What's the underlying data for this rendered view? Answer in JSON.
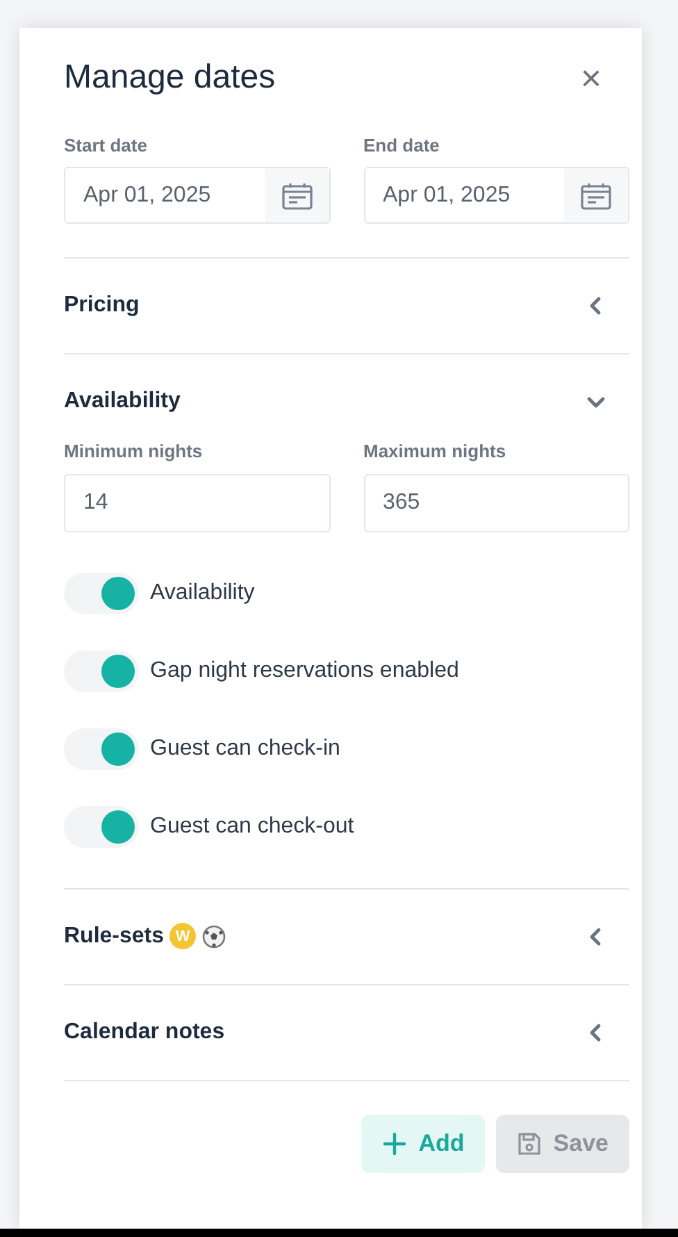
{
  "dialog": {
    "title": "Manage dates",
    "close": "×"
  },
  "dates": [
    {
      "label": "Start date",
      "value": "Apr 01, 2025"
    },
    {
      "label": "End date",
      "value": "Apr 01, 2025"
    }
  ],
  "sections": [
    {
      "kind": "plain",
      "title": "Pricing",
      "expanded": false
    },
    {
      "kind": "availability",
      "title": "Availability",
      "expanded": true,
      "fields": [
        {
          "label": "Minimum nights",
          "value": "14"
        },
        {
          "label": "Maximum nights",
          "value": "365"
        }
      ],
      "toggles": [
        {
          "label": "Availability",
          "on": true
        },
        {
          "label": "Gap night reservations enabled",
          "on": true
        },
        {
          "label": "Guest can check-in",
          "on": true
        },
        {
          "label": "Guest can check-out",
          "on": true
        }
      ]
    },
    {
      "kind": "badged",
      "title": "Rule-sets",
      "badge": "W",
      "expanded": false
    },
    {
      "kind": "plain",
      "title": "Calendar notes",
      "expanded": false
    }
  ],
  "buttons": [
    {
      "kind": "add",
      "label": "Add",
      "disabled": false
    },
    {
      "kind": "save",
      "label": "Save",
      "disabled": true
    }
  ]
}
